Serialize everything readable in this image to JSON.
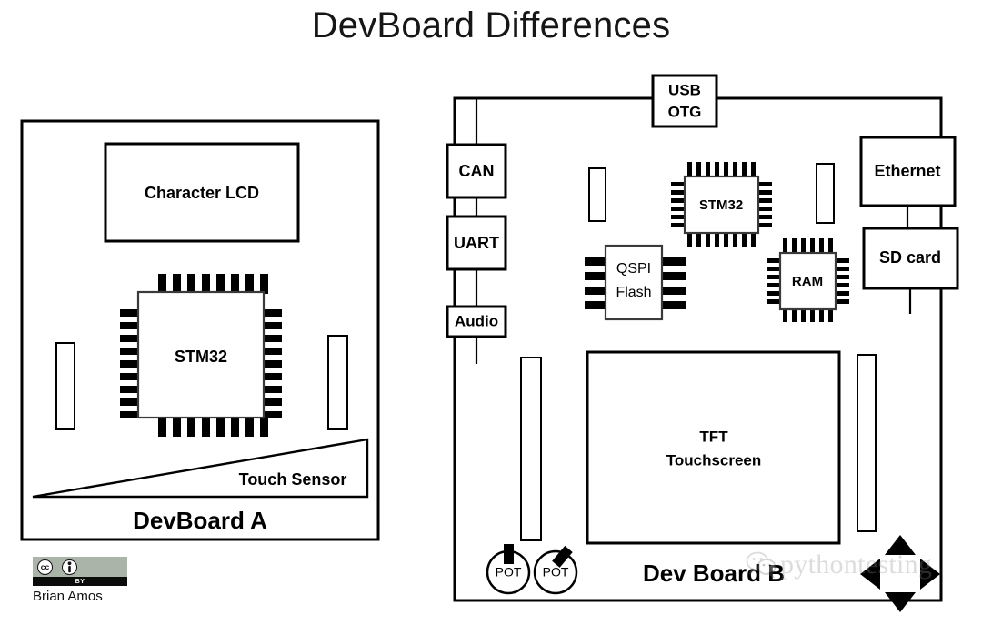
{
  "title": "DevBoard Differences",
  "board_a": {
    "name": "DevBoard A",
    "components": {
      "lcd": "Character LCD",
      "mcu": "STM32",
      "touch_sensor": "Touch Sensor"
    }
  },
  "board_b": {
    "name": "Dev Board B",
    "components": {
      "usb": "USB\nOTG",
      "usb_line1": "USB",
      "usb_line2": "OTG",
      "can": "CAN",
      "uart": "UART",
      "audio": "Audio",
      "mcu": "STM32",
      "qspi_line1": "QSPI",
      "qspi_line2": "Flash",
      "ram": "RAM",
      "ethernet": "Ethernet",
      "sdcard": "SD card",
      "tft_line1": "TFT",
      "tft_line2": "Touchscreen",
      "pot_1": "POT",
      "pot_2": "POT"
    }
  },
  "license": {
    "cc_mark": "cc",
    "by_mark": "BY",
    "person_glyph": "i",
    "author": "Brian Amos"
  },
  "watermark": {
    "text": "pythontesting"
  },
  "colors": {
    "ink": "#000000",
    "title_ink": "#161616",
    "chip_stroke": "#3a3a3a",
    "cc_band": "#aab4a8",
    "watermark": "#8d8d8d"
  }
}
